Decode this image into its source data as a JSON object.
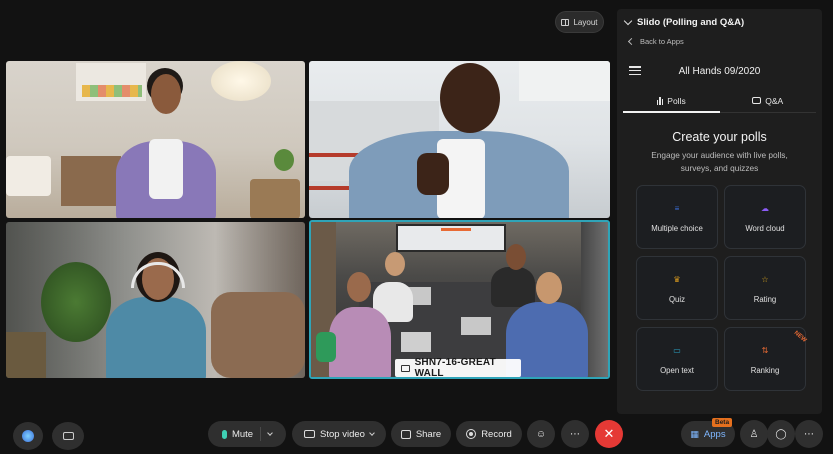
{
  "layout_button": {
    "label": "Layout"
  },
  "video": {
    "name_tag": "SHN7-16-GREAT WALL"
  },
  "panel": {
    "title": "Slido (Polling and Q&A)",
    "back_label": "Back to Apps",
    "event_title": "All Hands 09/2020",
    "tabs": [
      {
        "label": "Polls",
        "active": true
      },
      {
        "label": "Q&A",
        "active": false
      }
    ],
    "heading": "Create your polls",
    "subheading": "Engage your audience with live polls, surveys, and quizzes",
    "poll_types": [
      {
        "label": "Multiple choice",
        "icon": "list-icon",
        "color": "#3b6fd9"
      },
      {
        "label": "Word cloud",
        "icon": "cloud-icon",
        "color": "#8b5cf6"
      },
      {
        "label": "Quiz",
        "icon": "trophy-icon",
        "color": "#d99a1f"
      },
      {
        "label": "Rating",
        "icon": "star-icon",
        "color": "#d9a51f"
      },
      {
        "label": "Open text",
        "icon": "chat-bubble-icon",
        "color": "#2aa4c7"
      },
      {
        "label": "Ranking",
        "icon": "ranking-icon",
        "color": "#e86a34",
        "badge": "NEW"
      }
    ]
  },
  "toolbar": {
    "mute_label": "Mute",
    "stop_video_label": "Stop video",
    "share_label": "Share",
    "record_label": "Record",
    "apps_label": "Apps",
    "apps_badge": "Beta",
    "accent_mute": "#3fd0b4",
    "end_call_color": "#e53935"
  }
}
